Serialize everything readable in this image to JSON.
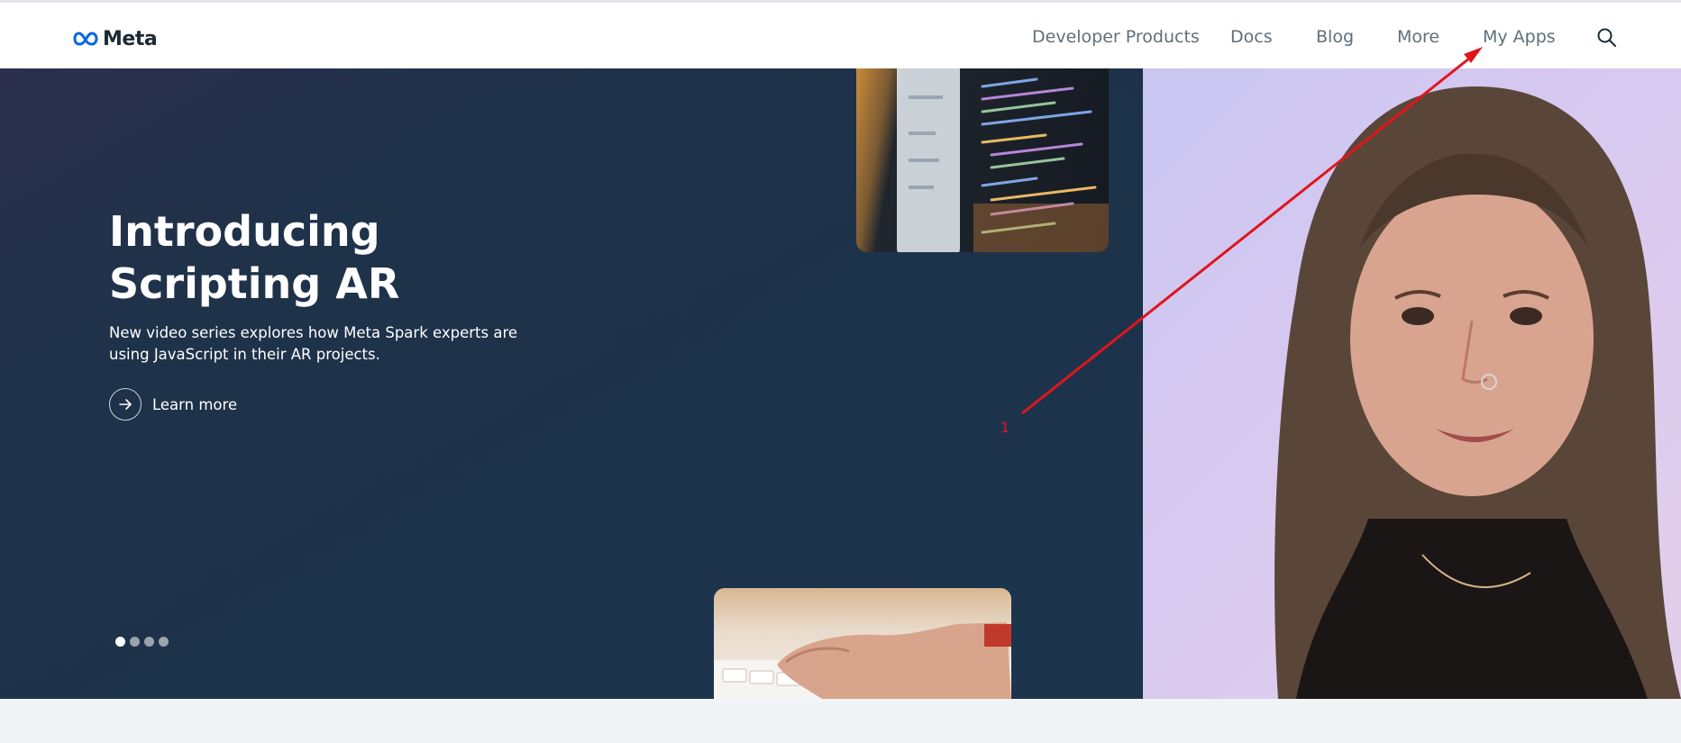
{
  "header": {
    "logo_text": "Meta",
    "nav": [
      "Developer Products",
      "Docs",
      "Blog",
      "More",
      "My Apps"
    ]
  },
  "hero": {
    "title": "Introducing Scripting AR",
    "subtitle": "New video series explores how Meta Spark experts are using JavaScript in their AR projects.",
    "cta_label": "Learn more",
    "carousel": {
      "count": 4,
      "active_index": 0
    }
  },
  "annotation": {
    "label": "1",
    "color": "#e0151b"
  },
  "colors": {
    "hero_bg": "#1c344c",
    "nav_text": "#5f6f7a",
    "logo_blue": "#0668e1"
  },
  "icons": [
    "meta-infinity-logo-icon",
    "search-icon",
    "arrow-right-icon"
  ]
}
